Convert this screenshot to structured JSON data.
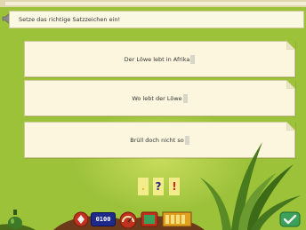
{
  "instruction": "Setze das richtige Satzzeichen ein!",
  "sentences": [
    {
      "text": "Der Löwe lebt in Afrika"
    },
    {
      "text": "Wo lebt der Löwe"
    },
    {
      "text": "Brüll doch nicht so"
    }
  ],
  "punctuation_choices": [
    {
      "symbol": ".",
      "color": "#e0b81f"
    },
    {
      "symbol": "?",
      "color": "#2a2a7a"
    },
    {
      "symbol": "!",
      "color": "#d42a1e"
    }
  ],
  "toolbar": {
    "counter_display": "0100"
  },
  "colors": {
    "background": "#9cc23a",
    "card": "#fbf6dd",
    "toolbar_red": "#c0321e"
  }
}
